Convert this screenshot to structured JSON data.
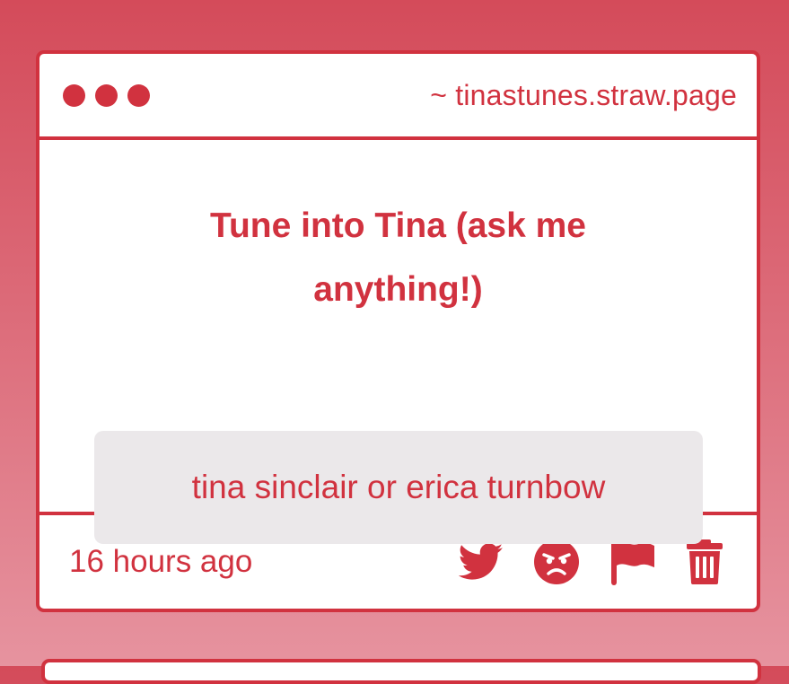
{
  "card": {
    "window_dots": [
      "dot",
      "dot",
      "dot"
    ],
    "url": "~ tinastunes.straw.page",
    "title": "Tune into Tina (ask me anything!)",
    "answer": "tina sinclair or erica turnbow",
    "timestamp": "16 hours ago",
    "actions": [
      {
        "name": "twitter-share-button",
        "icon": "twitter-bird-icon"
      },
      {
        "name": "angry-react-button",
        "icon": "angry-face-icon"
      },
      {
        "name": "report-button",
        "icon": "flag-icon"
      },
      {
        "name": "delete-button",
        "icon": "trash-icon"
      }
    ]
  },
  "colors": {
    "accent": "#d1323f",
    "card_bg": "#ffffff",
    "answer_bg": "#ebe8ea",
    "page_gradient_top": "#d44b5a",
    "page_gradient_bottom": "#e6939f"
  }
}
